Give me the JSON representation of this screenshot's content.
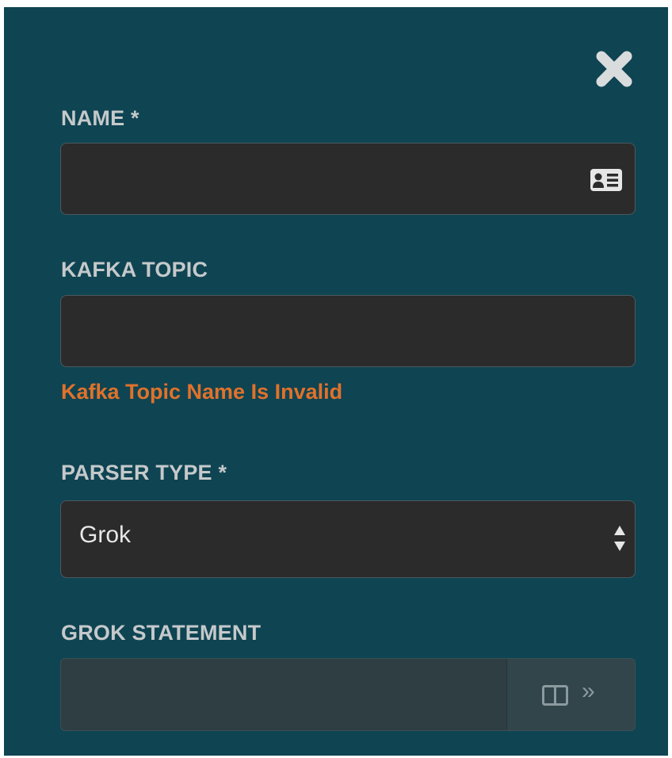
{
  "form": {
    "name_label": "NAME *",
    "name_value": "",
    "kafka_label": "KAFKA TOPIC",
    "kafka_value": "",
    "kafka_error": "Kafka Topic Name Is Invalid",
    "parser_label": "PARSER TYPE *",
    "parser_value": "Grok",
    "grok_label": "GROK STATEMENT",
    "grok_value": ""
  },
  "icons": {
    "close": "close-icon",
    "name_field": "id-card-icon",
    "select": "sort-arrows-icon",
    "split_view": "split-view-icon",
    "expand": "double-chevron-right-icon",
    "expand_glyph": "»"
  },
  "colors": {
    "panel_bg": "#0f4452",
    "field_bg": "#2b2b2b",
    "label": "#c5c9cb",
    "error": "#e0722b"
  }
}
